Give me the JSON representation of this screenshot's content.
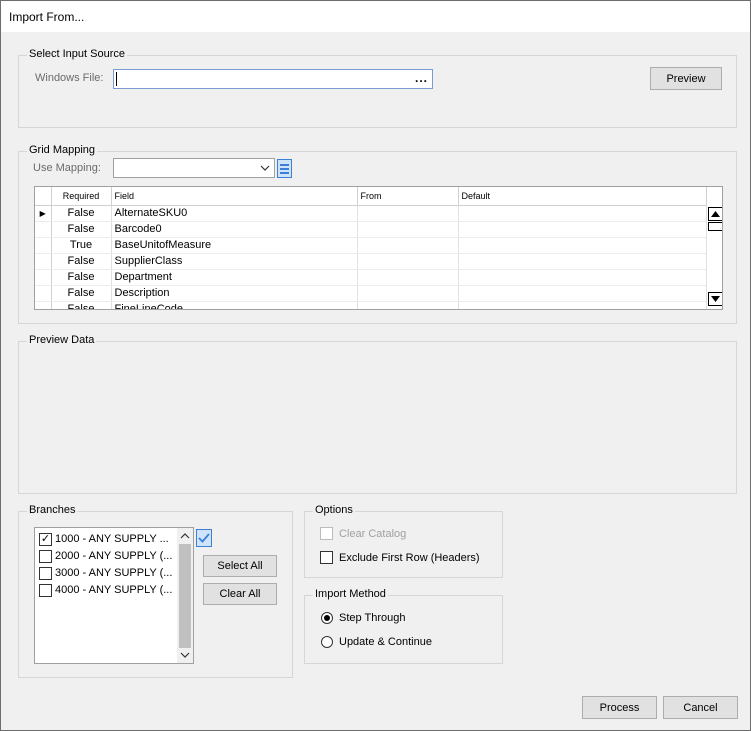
{
  "window": {
    "title": "Import From..."
  },
  "input_source": {
    "group_label": "Select Input Source",
    "windows_file_label": "Windows File:",
    "windows_file_value": "",
    "browse_label": "...",
    "preview_button": "Preview"
  },
  "grid_mapping": {
    "group_label": "Grid Mapping",
    "use_mapping_label": "Use Mapping:",
    "use_mapping_value": "",
    "columns": [
      "Required",
      "Field",
      "From",
      "Default"
    ],
    "rows": [
      {
        "required": "False",
        "field": "AlternateSKU0",
        "from": "",
        "default": ""
      },
      {
        "required": "False",
        "field": "Barcode0",
        "from": "",
        "default": ""
      },
      {
        "required": "True",
        "field": "BaseUnitofMeasure",
        "from": "",
        "default": ""
      },
      {
        "required": "False",
        "field": "SupplierClass",
        "from": "",
        "default": ""
      },
      {
        "required": "False",
        "field": "Department",
        "from": "",
        "default": ""
      },
      {
        "required": "False",
        "field": "Description",
        "from": "",
        "default": ""
      },
      {
        "required": "False",
        "field": "FineLineCode",
        "from": "",
        "default": ""
      }
    ]
  },
  "preview_data": {
    "group_label": "Preview Data"
  },
  "branches": {
    "group_label": "Branches",
    "items": [
      {
        "label": "1000 - ANY SUPPLY ...",
        "checked": true
      },
      {
        "label": "2000 - ANY SUPPLY (...",
        "checked": false
      },
      {
        "label": "3000 - ANY SUPPLY (...",
        "checked": false
      },
      {
        "label": "4000 - ANY SUPPLY (...",
        "checked": false
      }
    ],
    "select_all_button": "Select All",
    "clear_all_button": "Clear All"
  },
  "options": {
    "group_label": "Options",
    "clear_catalog_label": "Clear Catalog",
    "clear_catalog_checked": false,
    "exclude_first_row_label": "Exclude First Row (Headers)",
    "exclude_first_row_checked": false
  },
  "import_method": {
    "group_label": "Import Method",
    "step_through_label": "Step Through",
    "update_continue_label": "Update & Continue",
    "selected": "Step Through"
  },
  "footer": {
    "process_button": "Process",
    "cancel_button": "Cancel"
  },
  "colors": {
    "dialog_bg": "#f0f0f0",
    "focus_border": "#7a9cd3",
    "accent_blue": "#3c7fd6"
  }
}
